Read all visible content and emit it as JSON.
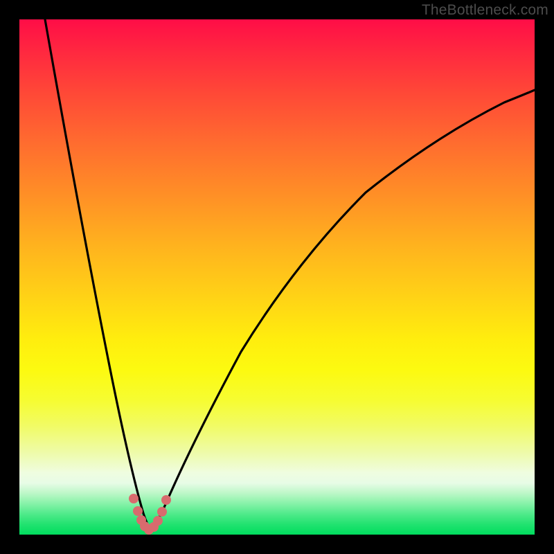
{
  "watermark": "TheBottleneck.com",
  "chart_data": {
    "type": "line",
    "title": "",
    "xlabel": "",
    "ylabel": "",
    "xlim": [
      0,
      100
    ],
    "ylim": [
      0,
      100
    ],
    "note": "No axes or tick labels rendered. Two non-linear curves descending to a common minimum near x≈25 then rising; background gradient encodes value (red high → green low).",
    "series": [
      {
        "name": "left-curve",
        "x": [
          5,
          10,
          15,
          20,
          22,
          24,
          25,
          26,
          28,
          30,
          35,
          40,
          50,
          60,
          70,
          80,
          90,
          100
        ],
        "values": [
          100,
          75,
          50,
          22,
          12,
          3,
          1,
          2,
          3,
          8,
          20,
          31,
          48,
          60,
          70,
          77,
          82,
          86
        ]
      }
    ],
    "markers": {
      "name": "near-minimum-dots",
      "x": [
        22.0,
        22.8,
        23.5,
        24.2,
        25.0,
        26.0,
        27.0,
        27.8,
        28.5
      ],
      "values": [
        7.5,
        5.0,
        3.0,
        1.8,
        1.0,
        1.6,
        2.8,
        4.8,
        7.2
      ],
      "color": "#d86b6e"
    }
  },
  "colors": {
    "frame": "#000000",
    "curve": "#000000",
    "marker": "#d86b6e",
    "watermark": "#4c4c4c"
  }
}
